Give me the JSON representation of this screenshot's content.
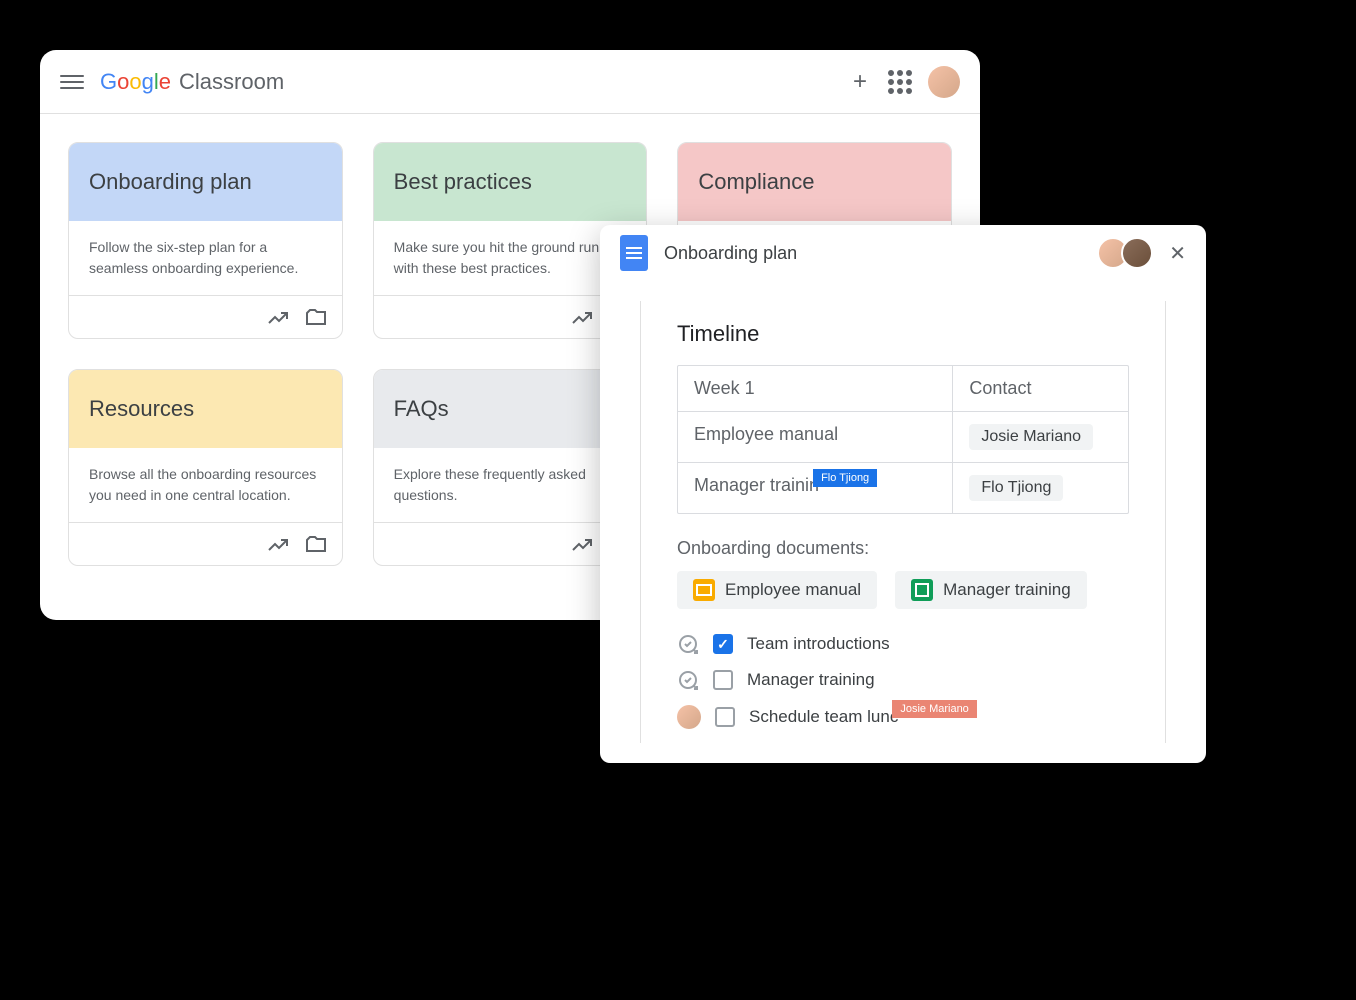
{
  "classroom": {
    "app_name_letters": [
      "G",
      "o",
      "o",
      "g",
      "l",
      "e"
    ],
    "app_product": "Classroom",
    "cards": [
      {
        "title": "Onboarding plan",
        "desc": "Follow the six-step plan for a seamless onboarding experience.",
        "color": "blue"
      },
      {
        "title": "Best practices",
        "desc": "Make sure you hit the ground running with these best practices.",
        "color": "green"
      },
      {
        "title": "Compliance",
        "desc": "",
        "color": "red"
      },
      {
        "title": "Resources",
        "desc": "Browse all the onboarding resources you need in one central location.",
        "color": "yellow"
      },
      {
        "title": "FAQs",
        "desc": "Explore these frequently asked questions.",
        "color": "grey"
      }
    ]
  },
  "docs": {
    "title": "Onboarding plan",
    "timeline_heading": "Timeline",
    "table": {
      "headers": [
        "Week 1",
        "Contact"
      ],
      "rows": [
        {
          "task": "Employee manual",
          "contact": "Josie Mariano"
        },
        {
          "task": "Manager trainin",
          "contact": "Flo Tjiong",
          "editor": "Flo Tjiong"
        }
      ]
    },
    "onboarding_label": "Onboarding documents:",
    "pills": [
      {
        "label": "Employee manual",
        "type": "slides"
      },
      {
        "label": "Manager training",
        "type": "sheets"
      }
    ],
    "checklist": [
      {
        "label": "Team introductions",
        "checked": true,
        "icon": "task"
      },
      {
        "label": "Manager training",
        "checked": false,
        "icon": "task"
      },
      {
        "label": "Schedule team lunc",
        "checked": false,
        "icon": "avatar",
        "editor": "Josie Mariano"
      }
    ]
  }
}
